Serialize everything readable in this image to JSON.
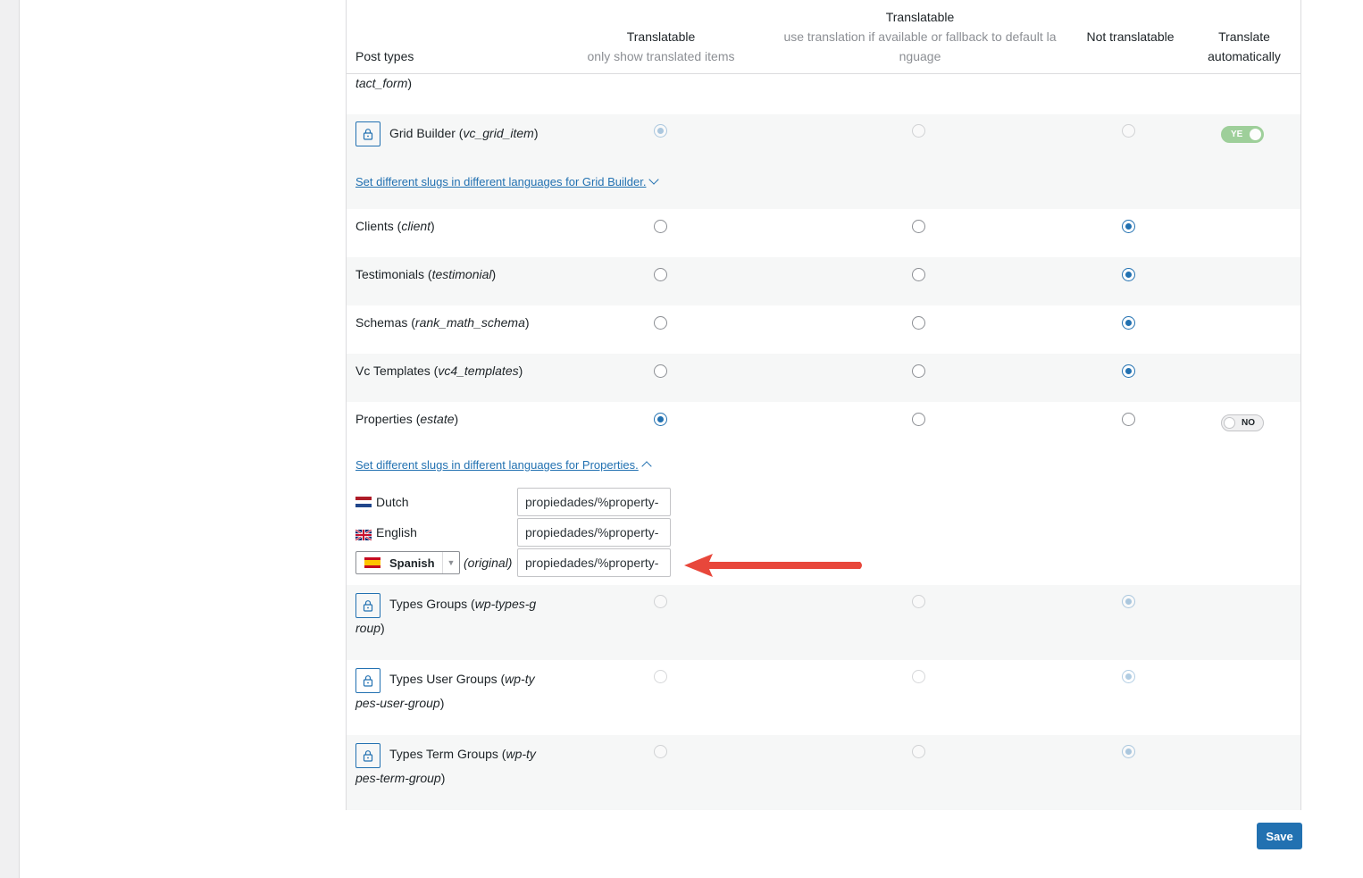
{
  "headers": {
    "post_types": "Post types",
    "translatable": "Translatable",
    "translatable_sub": "only show translated items",
    "fallback": "Translatable",
    "fallback_sub_1": "use translation if available or fallback to default la",
    "fallback_sub_2": "nguage",
    "not_translatable": "Not translatable",
    "auto_1": "Translate",
    "auto_2": "automatically"
  },
  "partial_row": {
    "type": "tact_form",
    "close": ")"
  },
  "rows": {
    "grid_builder": {
      "name": "Grid Builder (",
      "type": "vc_grid_item",
      "close": ")",
      "selected": "translatable",
      "locked": true,
      "auto_toggle": "YE",
      "slug_link": "Set different slugs in different languages for Grid Builder."
    },
    "clients": {
      "name": "Clients (",
      "type": "client",
      "close": ")",
      "selected": "not_translatable"
    },
    "testimonials": {
      "name": "Testimonials (",
      "type": "testimonial",
      "close": ")",
      "selected": "not_translatable"
    },
    "schemas": {
      "name": "Schemas (",
      "type": "rank_math_schema",
      "close": ")",
      "selected": "not_translatable"
    },
    "vc_templates": {
      "name": "Vc Templates (",
      "type": "vc4_templates",
      "close": ")",
      "selected": "not_translatable"
    },
    "properties": {
      "name": "Properties (",
      "type": "estate",
      "close": ")",
      "selected": "translatable",
      "auto_toggle": "NO",
      "slug_link": "Set different slugs in different languages for Properties.",
      "slugs": {
        "dutch": {
          "label": "Dutch",
          "value": "propiedades/%property-"
        },
        "english": {
          "label": "English",
          "value": "propiedades/%property-"
        },
        "spanish": {
          "label": "Spanish",
          "original": "(original)",
          "value": "propiedades/%property-"
        }
      }
    },
    "types_groups": {
      "name": "Types Groups (",
      "type_1": "wp-types-g",
      "type_2": "roup",
      "close": ")",
      "selected": "not_translatable",
      "locked": true
    },
    "types_user_groups": {
      "name": "Types User Groups (",
      "type_1": "wp-ty",
      "type_2": "pes-user-group",
      "close": ")",
      "selected": "not_translatable",
      "locked": true
    },
    "types_term_groups": {
      "name": "Types Term Groups (",
      "type_1": "wp-ty",
      "type_2": "pes-term-group",
      "close": ")",
      "selected": "not_translatable",
      "locked": true
    }
  },
  "save_label": "Save",
  "colors": {
    "accent": "#2271b1",
    "toggle_on": "#8fc98a",
    "annotation_arrow": "#e8473b"
  },
  "icons": {
    "lock": "lock-icon",
    "chevron_down": "chevron-down-icon",
    "chevron_up": "chevron-up-icon",
    "arrow": "arrow-left-icon"
  }
}
